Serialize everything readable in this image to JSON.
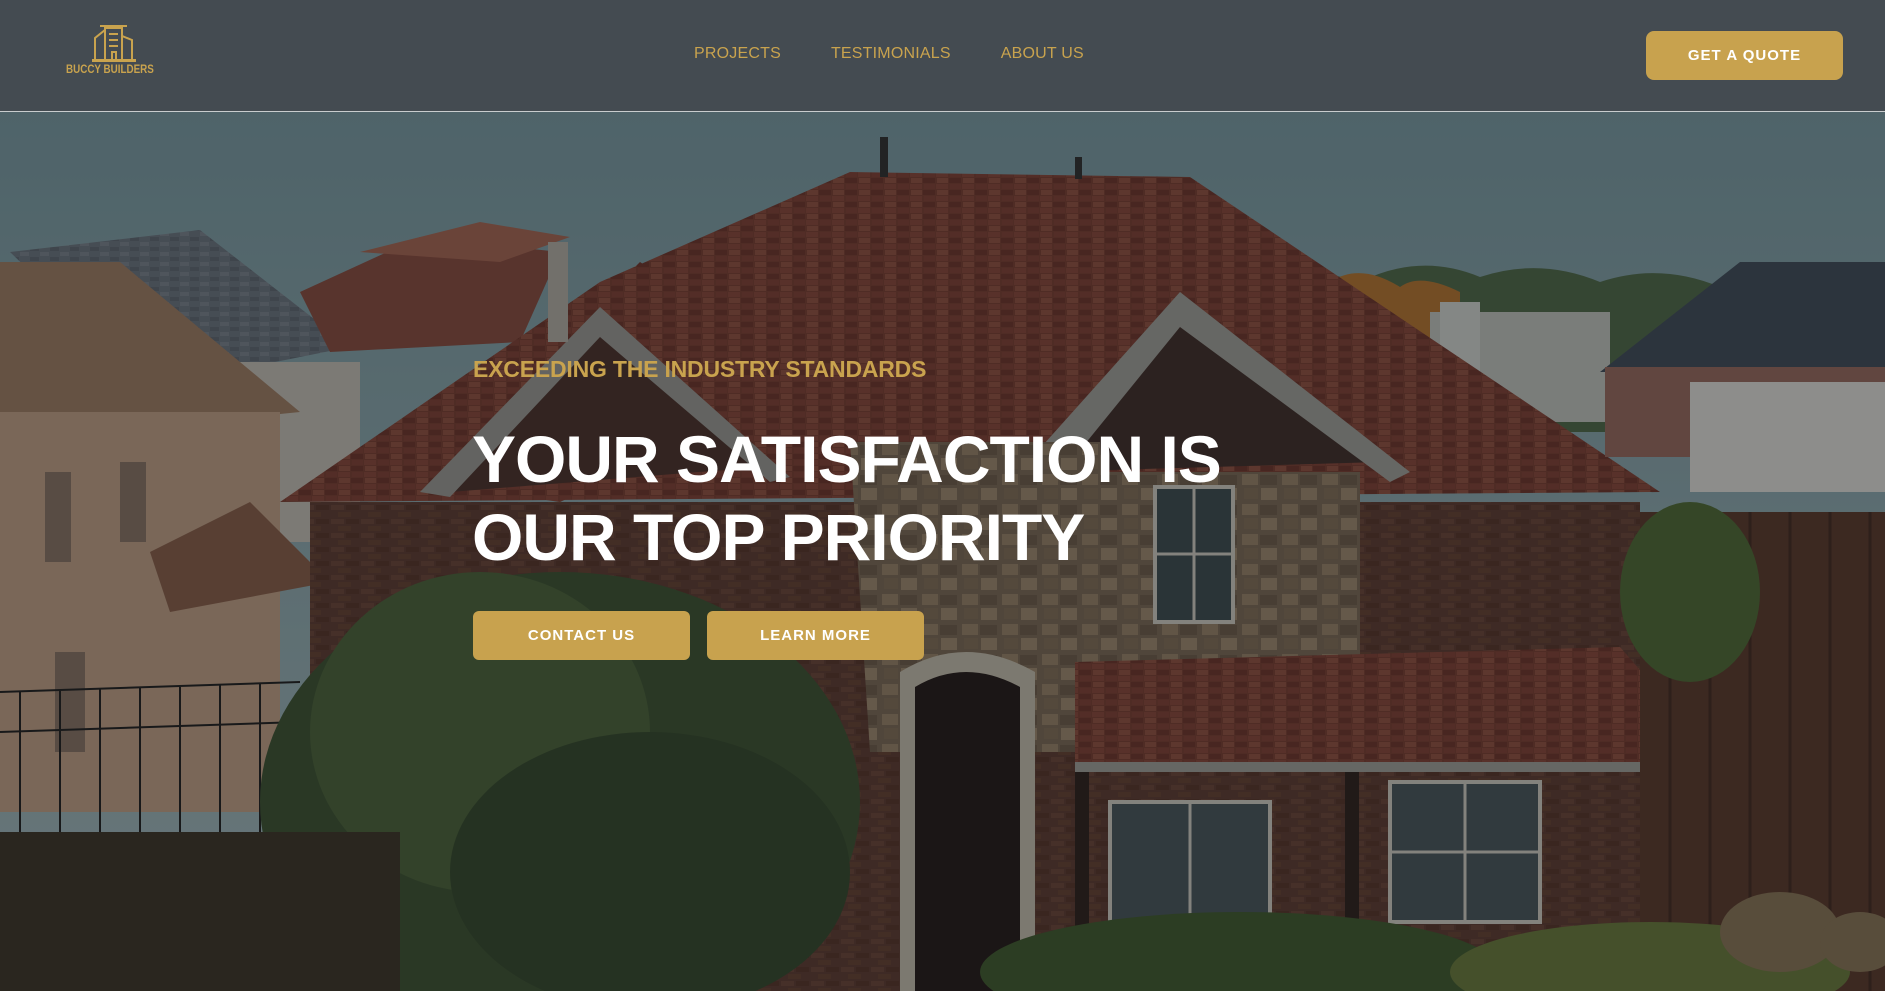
{
  "header": {
    "logo": {
      "text_part1": "BUCCY",
      "text_part2": "BUILDERS",
      "icon": "building-logo-icon"
    },
    "nav": [
      {
        "label": "PROJECTS"
      },
      {
        "label": "TESTIMONIALS"
      },
      {
        "label": "ABOUT US"
      }
    ],
    "cta_label": "GET A QUOTE"
  },
  "hero": {
    "eyebrow": "EXCEEDING THE INDUSTRY STANDARDS",
    "headline": "YOUR SATISFACTION IS OUR TOP PRIORITY",
    "buttons": {
      "contact_label": "CONTACT US",
      "learn_label": "LEARN MORE"
    },
    "background": "house-photo"
  },
  "colors": {
    "accent": "#c8a24e",
    "header_bg": "#444b51",
    "text_light": "#ffffff"
  }
}
